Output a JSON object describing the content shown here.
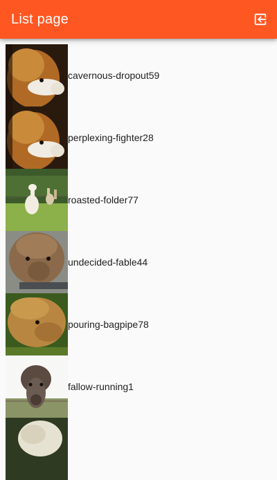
{
  "app_bar": {
    "title": "List page",
    "logout_icon": "logout-icon",
    "background": "#ff5722"
  },
  "list": {
    "items": [
      {
        "label": "cavernous-dropout59",
        "image": "alpaca-photo"
      },
      {
        "label": "perplexing-fighter28",
        "image": "alpaca-photo"
      },
      {
        "label": "roasted-folder77",
        "image": "alpaca-photo"
      },
      {
        "label": "undecided-fable44",
        "image": "alpaca-photo"
      },
      {
        "label": "pouring-bagpipe78",
        "image": "alpaca-photo"
      },
      {
        "label": "fallow-running1",
        "image": "alpaca-photo"
      },
      {
        "label": "",
        "image": "alpaca-photo"
      }
    ]
  }
}
